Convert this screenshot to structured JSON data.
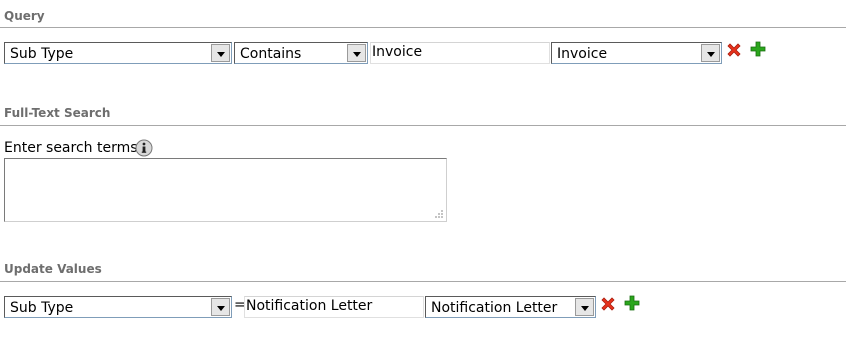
{
  "query": {
    "title": "Query",
    "field_select": "Sub Type",
    "operator_select": "Contains",
    "value_input": "Invoice",
    "value_select": "Invoice"
  },
  "fulltext": {
    "title": "Full-Text Search",
    "label": "Enter search terms",
    "textarea_value": ""
  },
  "update": {
    "title": "Update Values",
    "field_select": "Sub Type",
    "equals": "=",
    "value_input": "Notification Letter",
    "value_select": "Notification Letter"
  },
  "icons": {
    "delete": "red-x-delete-icon",
    "add": "green-plus-add-icon",
    "info": "info-icon",
    "colors": {
      "delete": "#e8321c",
      "add": "#2aa61c",
      "section_title": "#6e6e6e"
    }
  }
}
